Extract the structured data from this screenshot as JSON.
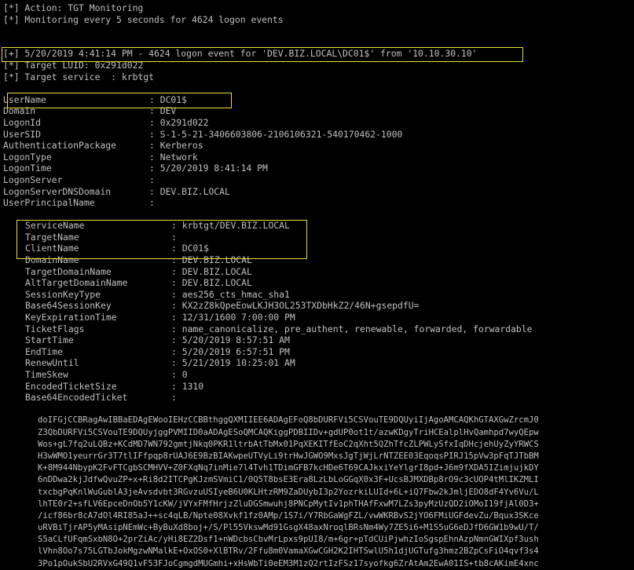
{
  "header": [
    "[*] Action: TGT Monitoring",
    "[*] Monitoring every 5 seconds for 4624 logon events"
  ],
  "event": [
    "[+] 5/20/2019 4:41:14 PM - 4624 logon event for 'DEV.BIZ.LOCAL\\DC01$' from '10.10.30.10'",
    "[*] Target LUID: 0x291d022",
    "[*] Target service  : krbtgt"
  ],
  "logon_session": [
    {
      "key": "UserName",
      "value": "DC01$"
    },
    {
      "key": "Domain",
      "value": "DEV"
    },
    {
      "key": "LogonId",
      "value": "0x291d022"
    },
    {
      "key": "UserSID",
      "value": "S-1-5-21-3406603806-2106106321-540170462-1000"
    },
    {
      "key": "AuthenticationPackage",
      "value": "Kerberos"
    },
    {
      "key": "LogonType",
      "value": "Network"
    },
    {
      "key": "LogonTime",
      "value": "5/20/2019 8:41:14 PM"
    },
    {
      "key": "LogonServer",
      "value": ""
    },
    {
      "key": "LogonServerDNSDomain",
      "value": "DEV.BIZ.LOCAL"
    },
    {
      "key": "UserPrincipalName",
      "value": ""
    }
  ],
  "ticket": [
    {
      "key": "ServiceName",
      "value": "krbtgt/DEV.BIZ.LOCAL"
    },
    {
      "key": "TargetName",
      "value": ""
    },
    {
      "key": "ClientName",
      "value": "DC01$"
    },
    {
      "key": "DomainName",
      "value": "DEV.BIZ.LOCAL"
    },
    {
      "key": "TargetDomainName",
      "value": "DEV.BIZ.LOCAL"
    },
    {
      "key": "AltTargetDomainName",
      "value": "DEV.BIZ.LOCAL"
    },
    {
      "key": "SessionKeyType",
      "value": "aes256_cts_hmac_sha1"
    },
    {
      "key": "Base64SessionKey",
      "value": "KX2zZ8kQpeEowLKJH3OL253TXDbHkZ2/46N+gsepdfU="
    },
    {
      "key": "KeyExpirationTime",
      "value": "12/31/1600 7:00:00 PM"
    },
    {
      "key": "TicketFlags",
      "value": "name_canonicalize, pre_authent, renewable, forwarded, forwardable"
    },
    {
      "key": "StartTime",
      "value": "5/20/2019 8:57:51 AM"
    },
    {
      "key": "EndTime",
      "value": "5/20/2019 6:57:51 PM"
    },
    {
      "key": "RenewUntil",
      "value": "5/21/2019 10:25:01 AM"
    },
    {
      "key": "TimeSkew",
      "value": "0"
    },
    {
      "key": "EncodedTicketSize",
      "value": "1310"
    },
    {
      "key": "Base64EncodedTicket",
      "value": ""
    }
  ],
  "encoded_ticket_lines": [
    "doIFGjCCBRagAwIBBaEDAgEWooIEHzCCBBthggQXMIIEE6ADAgEFoQ8bDURFVi5CSVouTE9DQUyiIjAgoAMCAQKhGTAXGwZrcmJ0",
    "Z3QbDURFVi5CSVouTE9DQUyjggPVMIID0aADAgESoQMCAQKiggPDBIIDv+gdUP0ot1t/azwKDgyTriHCEalplHvQamhpd7wyQEpw",
    "Wos+gL7fq2uLQBz+KCdMD7WN792gmtjNkq0PKR1ltrbAtTbMx01PqXEKITfEoC2qXht5QZhTfcZLPWLySfxIqDHcjehUyZyYRWCS",
    "H3wWMO1yeurrGr3T7tlIFfpqp8rUAJ6E9BzBIAKwpeUTVyLi9trHwJGWO9MxsJgTjWjLrNTZEE03EqoqsPIRJ15pVw3pFqTJTbBM",
    "K+8M944NbypK2FvFTCgbSCMHVV+Z0FXqNq7inMie7l4Tvh1TDimGFB7kcHDe6T69CAJkxiYeYlgrI8pd+J6m9fXDA5IZimjujkDY",
    "6nDDwa2kjJdfwQvuZP+x+Ri8d2ITCPgKJzmSVmiC1/0Q5T8bsE3Era8LzLbLoGGqX0x3F+UcsBJMXDBp8rO9c3cUOP4tMlIKZMLI",
    "txcbgPqKnlWuGublA3jeAvsdvbt3RGvzuUSIyeB6U0KLHtzRM9ZaDUybI3p2YozrkiLUId+6L+iQ7Fbw2kJmljEDO8dF4Yv6Vu/L",
    "lhTE0r2+sfLV6EpceDnOb5Y1cKW/jVYxFMfHrjzZluDGSmwuhj8PNCpMytIv1phTHAfFxwM7LZs3pyMzUzQD2iOMoI19fjAl0D3+",
    "/icf86br8cA7dOl4RI85aJ++sc4qLB/Npte08Xvkf1fz0AMp/1S7i/Y7RbGaWgFZL/vwWKRBvS2jYO6FMiUGFdevZu/Bqux3SKce",
    "uRVBiTjrAP5yMAsipNEmWc+ByBuXd8boj+/S/Pl55VkswMd91GsgX48axNroqlBRsNm4Wy7ZE5i6+M1S5uG6eDJfD6GW1b9wU/T/",
    "S5aCLfUFqmSxbN8O+2prZiAc/yHi8EZ2Dsf1+nWDcbsCbvMrLpxs9pUI8/m+6gr+pTdCUiPjwhzIoSgspEhnAzpNmnGWIXpf3ush",
    "lVhn8Oo7s75LGTbJokMgzwNMalkE+OxOS0+XlBTRv/2Ffu8m0VamaXGwCGH2K2IHTSwlU5h1djUGTufg3hmz2BZpCsFiO4qvf3s4",
    "3Po1pOukSbU2RVxG49Q1vF53FJoCgmgdMUGmhi+xHsWbTi0eEM3M1zQ2rtIzFSz17syofkg6ZrAtAm2EwA01IS+tb8cAKimE4xnc"
  ],
  "colors": {
    "background": "#000000",
    "text": "#c0c0c0",
    "highlight": "#e7df3a"
  }
}
